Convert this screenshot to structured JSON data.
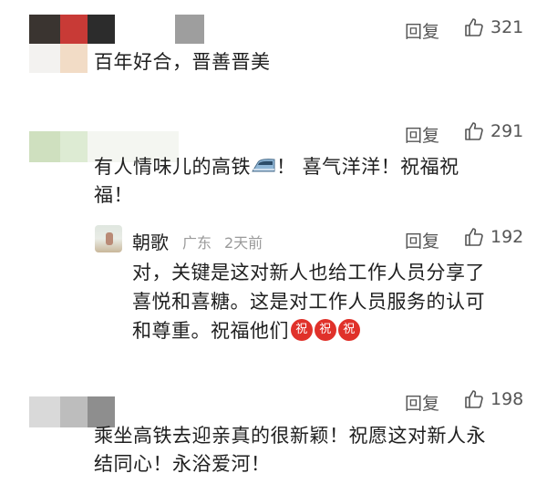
{
  "comments": [
    {
      "text": "百年好合，晋善晋美",
      "reply_label": "回复",
      "like_count": "321"
    },
    {
      "text_line1": "有人情味儿的高铁",
      "text_line1b": "！ 喜气洋洋！祝福祝",
      "text_line2": "福！",
      "reply_label": "回复",
      "like_count": "291",
      "reply": {
        "username": "朝歌",
        "location": "广东",
        "time": "2天前",
        "text_line1": "对，关键是这对新人也给工作人员分享了",
        "text_line2": "喜悦和喜糖。这是对工作人员服务的认可",
        "text_line3": "和尊重。祝福他们",
        "emoji_glyph": "祝",
        "reply_label": "回复",
        "like_count": "192"
      }
    },
    {
      "text_line1": "乘坐高铁去迎亲真的很新颖！祝愿这对新人永",
      "text_line2": "结同心！永浴爱河！",
      "reply_label": "回复",
      "like_count": "198"
    }
  ],
  "icons": {
    "like": "thumbs-up-icon",
    "train": "high-speed-train-emoji-icon",
    "blessing": "blessing-emoji-icon"
  },
  "colors": {
    "blessing_emoji": "#e0312a",
    "secondary_text": "#555555",
    "meta_text": "#9a9a9a"
  }
}
